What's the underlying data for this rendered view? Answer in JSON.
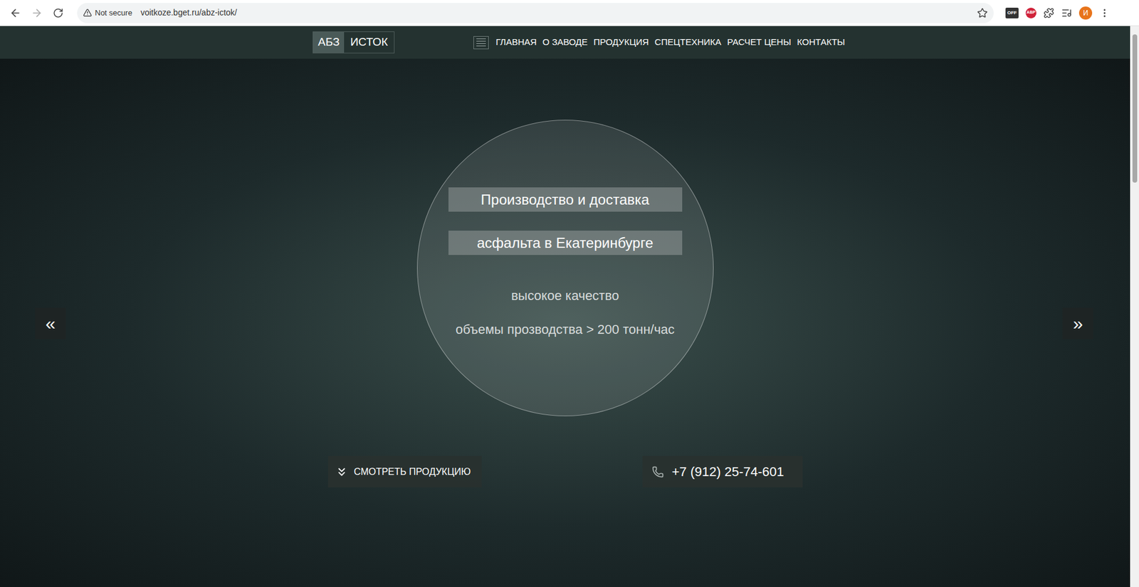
{
  "browser": {
    "security_label": "Not secure",
    "url": "voitkoze.bget.ru/abz-ictok/",
    "extensions": [
      "OFF",
      "ABP"
    ],
    "profile_initial": "И"
  },
  "site": {
    "logo": [
      "АБЗ",
      "ИСТОК"
    ],
    "nav": [
      {
        "label": "ГЛАВНАЯ"
      },
      {
        "label": "О ЗАВОДЕ"
      },
      {
        "label": "ПРОДУКЦИЯ"
      },
      {
        "label": "СПЕЦТЕХНИКА"
      },
      {
        "label": "РАСЧЕТ ЦЕНЫ"
      },
      {
        "label": "КОНТАКТЫ"
      }
    ]
  },
  "hero": {
    "headlines": [
      "Производство и доставка",
      "асфальта в Екатеринбурге"
    ],
    "taglines": [
      "высокое качество",
      "объемы прозводства > 200 тонн/час"
    ],
    "prev": "«",
    "next": "»",
    "buttons": [
      {
        "label": "СМОТРЕТЬ ПРОДУКЦИЮ",
        "kind": "scroll"
      },
      {
        "label": "+7 (912) 25-74-601",
        "kind": "phone"
      }
    ]
  }
}
